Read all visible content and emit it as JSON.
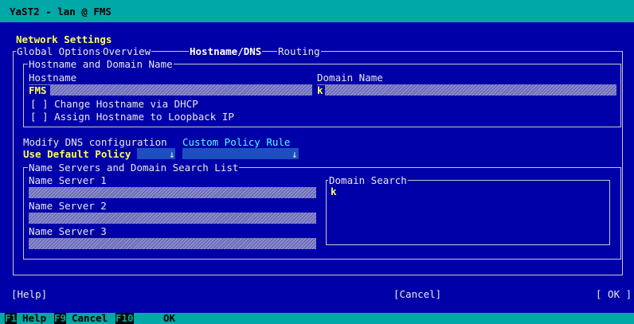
{
  "window": {
    "title": "YaST2 - lan @ FMS"
  },
  "dialog": {
    "title": "Network Settings"
  },
  "tabs": [
    {
      "label": "Global Options",
      "active": false
    },
    {
      "label": "Overview",
      "active": false
    },
    {
      "label": "Hostname/DNS",
      "active": true
    },
    {
      "label": "Routing",
      "active": false
    }
  ],
  "hostname_group": {
    "legend": "Hostname and Domain Name",
    "hostname_label": "Hostname",
    "hostname_value": "FMS",
    "domain_label": "Domain Name",
    "domain_value": "k",
    "dhcp_checkbox": "[ ] Change Hostname via DHCP",
    "loopback_checkbox": "[ ] Assign Hostname to Loopback IP"
  },
  "dns_config": {
    "label": "Modify DNS configuration",
    "custom_label": "Custom Policy Rule",
    "policy_value": "Use Default Policy",
    "arrow": "↓"
  },
  "nameservers_group": {
    "legend": "Name Servers and Domain Search List",
    "ns1_label": "Name Server 1",
    "ns2_label": "Name Server 2",
    "ns3_label": "Name Server 3",
    "search_legend": "Domain Search",
    "search_value": "k"
  },
  "buttons": {
    "help": "[Help]",
    "cancel": "[Cancel]",
    "ok": "[ OK ]"
  },
  "function_keys": [
    {
      "key": "F1",
      "label": "Help"
    },
    {
      "key": "F9",
      "label": "Cancel"
    },
    {
      "key": "F10",
      "label": "OK"
    }
  ]
}
